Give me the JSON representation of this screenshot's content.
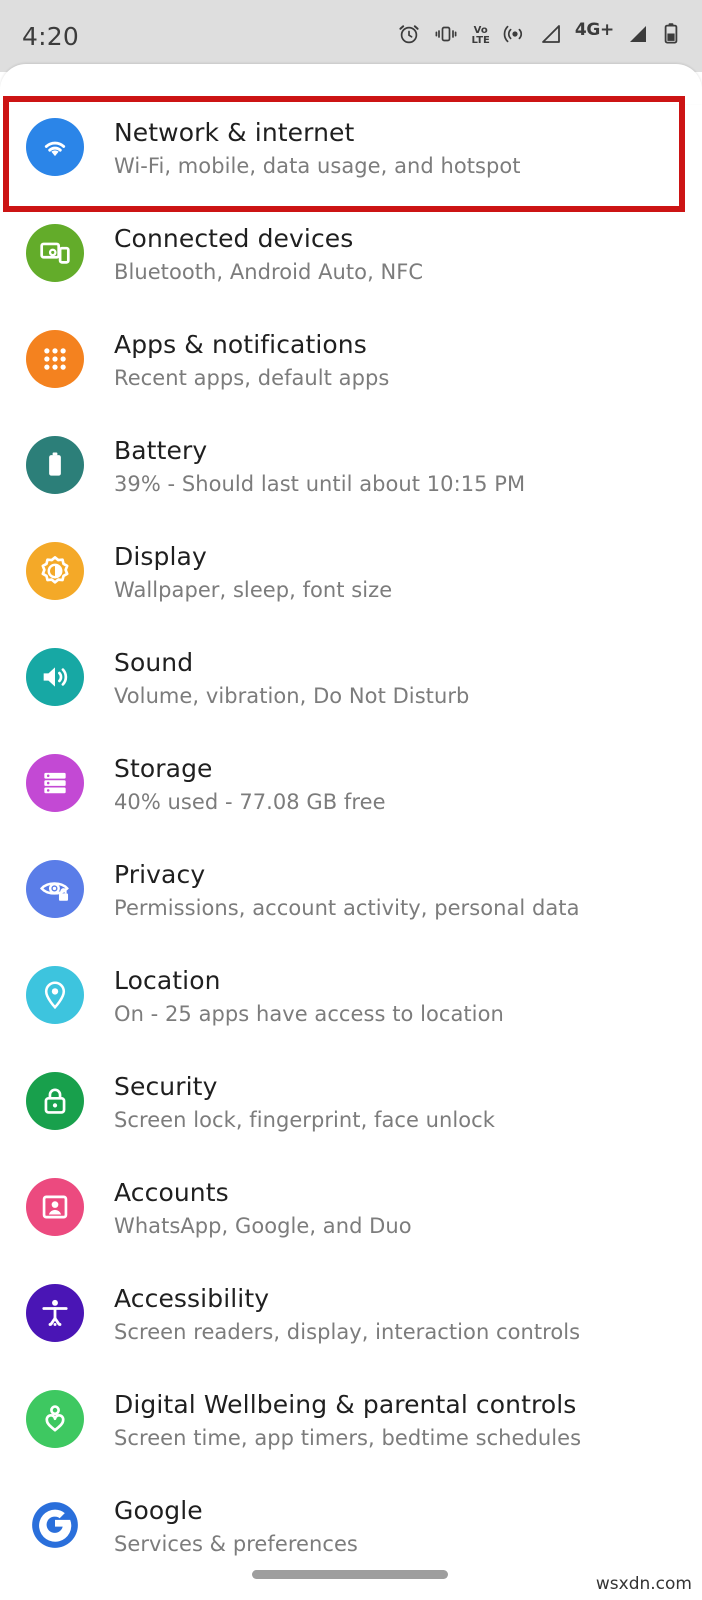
{
  "status_bar": {
    "time": "4:20",
    "icons": [
      {
        "name": "alarm-icon",
        "label": "alarm"
      },
      {
        "name": "vibrate-icon",
        "label": "vibrate"
      },
      {
        "name": "volte-icon",
        "label_top": "Vo",
        "label_bottom": "LTE"
      },
      {
        "name": "hotspot-icon",
        "label": "hotspot"
      },
      {
        "name": "signal-empty-icon",
        "label": "signal sim 1"
      },
      {
        "name": "network-type-label",
        "label": "4G+"
      },
      {
        "name": "signal-full-icon",
        "label": "signal sim 2"
      },
      {
        "name": "battery-icon",
        "label": "battery"
      }
    ]
  },
  "highlight": {
    "color": "#cc1414",
    "target": "Network & internet"
  },
  "settings": {
    "items": [
      {
        "id": "network-internet",
        "title": "Network & internet",
        "subtitle": "Wi-Fi, mobile, data usage, and hotspot",
        "icon": "wifi-icon",
        "color": "#2b85e8"
      },
      {
        "id": "connected-devices",
        "title": "Connected devices",
        "subtitle": "Bluetooth, Android Auto, NFC",
        "icon": "devices-icon",
        "color": "#63ac2a"
      },
      {
        "id": "apps-notifications",
        "title": "Apps & notifications",
        "subtitle": "Recent apps, default apps",
        "icon": "apps-grid-icon",
        "color": "#f4821f"
      },
      {
        "id": "battery",
        "title": "Battery",
        "subtitle": "39% - Should last until about 10:15 PM",
        "icon": "battery-icon",
        "color": "#2c7f79"
      },
      {
        "id": "display",
        "title": "Display",
        "subtitle": "Wallpaper, sleep, font size",
        "icon": "brightness-icon",
        "color": "#f4a928"
      },
      {
        "id": "sound",
        "title": "Sound",
        "subtitle": "Volume, vibration, Do Not Disturb",
        "icon": "volume-icon",
        "color": "#17a8a4"
      },
      {
        "id": "storage",
        "title": "Storage",
        "subtitle": "40% used - 77.08 GB free",
        "icon": "storage-icon",
        "color": "#c349d4"
      },
      {
        "id": "privacy",
        "title": "Privacy",
        "subtitle": "Permissions, account activity, personal data",
        "icon": "eye-lock-icon",
        "color": "#5a7de8"
      },
      {
        "id": "location",
        "title": "Location",
        "subtitle": "On - 25 apps have access to location",
        "icon": "location-pin-icon",
        "color": "#3dc4de"
      },
      {
        "id": "security",
        "title": "Security",
        "subtitle": "Screen lock, fingerprint, face unlock",
        "icon": "lock-icon",
        "color": "#18a04c"
      },
      {
        "id": "accounts",
        "title": "Accounts",
        "subtitle": "WhatsApp, Google, and Duo",
        "icon": "account-card-icon",
        "color": "#ec4a7f"
      },
      {
        "id": "accessibility",
        "title": "Accessibility",
        "subtitle": "Screen readers, display, interaction controls",
        "icon": "accessibility-icon",
        "color": "#4a15b5"
      },
      {
        "id": "digital-wellbeing",
        "title": "Digital Wellbeing & parental controls",
        "subtitle": "Screen time, app timers, bedtime schedules",
        "icon": "heart-person-icon",
        "color": "#3ec861"
      },
      {
        "id": "google",
        "title": "Google",
        "subtitle": "Services & preferences",
        "icon": "google-g-icon",
        "color": "#2a6fdb"
      }
    ]
  },
  "watermark": {
    "text": "wsxdn.com"
  }
}
